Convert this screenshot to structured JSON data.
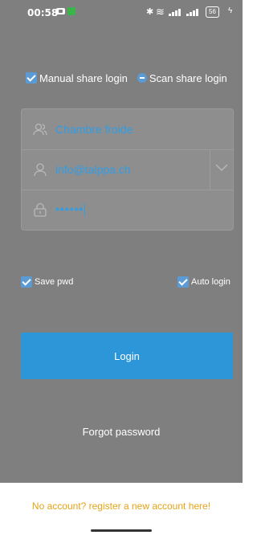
{
  "status_bar": {
    "time": "00:58",
    "battery": "56"
  },
  "login_type": {
    "manual_label": "Manual share login",
    "scan_label": "Scan share login"
  },
  "form": {
    "name_value": "Chambre froide",
    "email_value": "info@talppa.ch",
    "password_mask": "••••••"
  },
  "options": {
    "save_pwd_label": "Save pwd",
    "auto_login_label": "Auto login"
  },
  "login_button_label": "Login",
  "forgot_password_label": "Forgot password",
  "register_link": "No account? register a new account here!",
  "colors": {
    "accent": "#2d96d8",
    "text_blue": "#2f9de8",
    "register": "#e8a317",
    "overlay": "#7f7f7f"
  }
}
